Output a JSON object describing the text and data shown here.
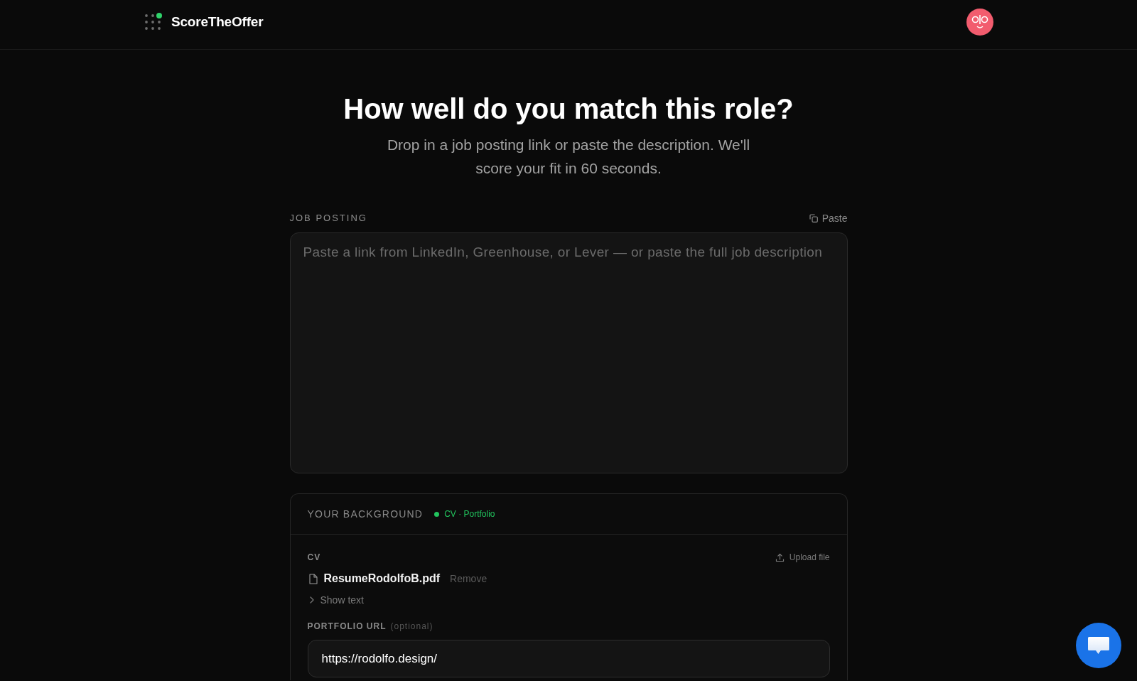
{
  "header": {
    "brand": "ScoreTheOffer"
  },
  "hero": {
    "title": "How well do you match this role?",
    "subtitle": "Drop in a job posting link or paste the description. We'll score your fit in 60 seconds."
  },
  "job_posting": {
    "label": "JOB POSTING",
    "paste_button": "Paste",
    "placeholder": "Paste a link from LinkedIn, Greenhouse, or Lever — or paste the full job description"
  },
  "background": {
    "title": "YOUR BACKGROUND",
    "status": {
      "text": "CV · Portfolio",
      "complete": true
    },
    "cv": {
      "label": "CV",
      "upload_button": "Upload file",
      "file_name": "ResumeRodolfoB.pdf",
      "remove_button": "Remove",
      "toggle": {
        "label": "Show text",
        "expanded": false
      }
    },
    "portfolio": {
      "label": "PORTFOLIO URL",
      "hint": "(optional)",
      "value": "https://rodolfo.design/"
    }
  }
}
